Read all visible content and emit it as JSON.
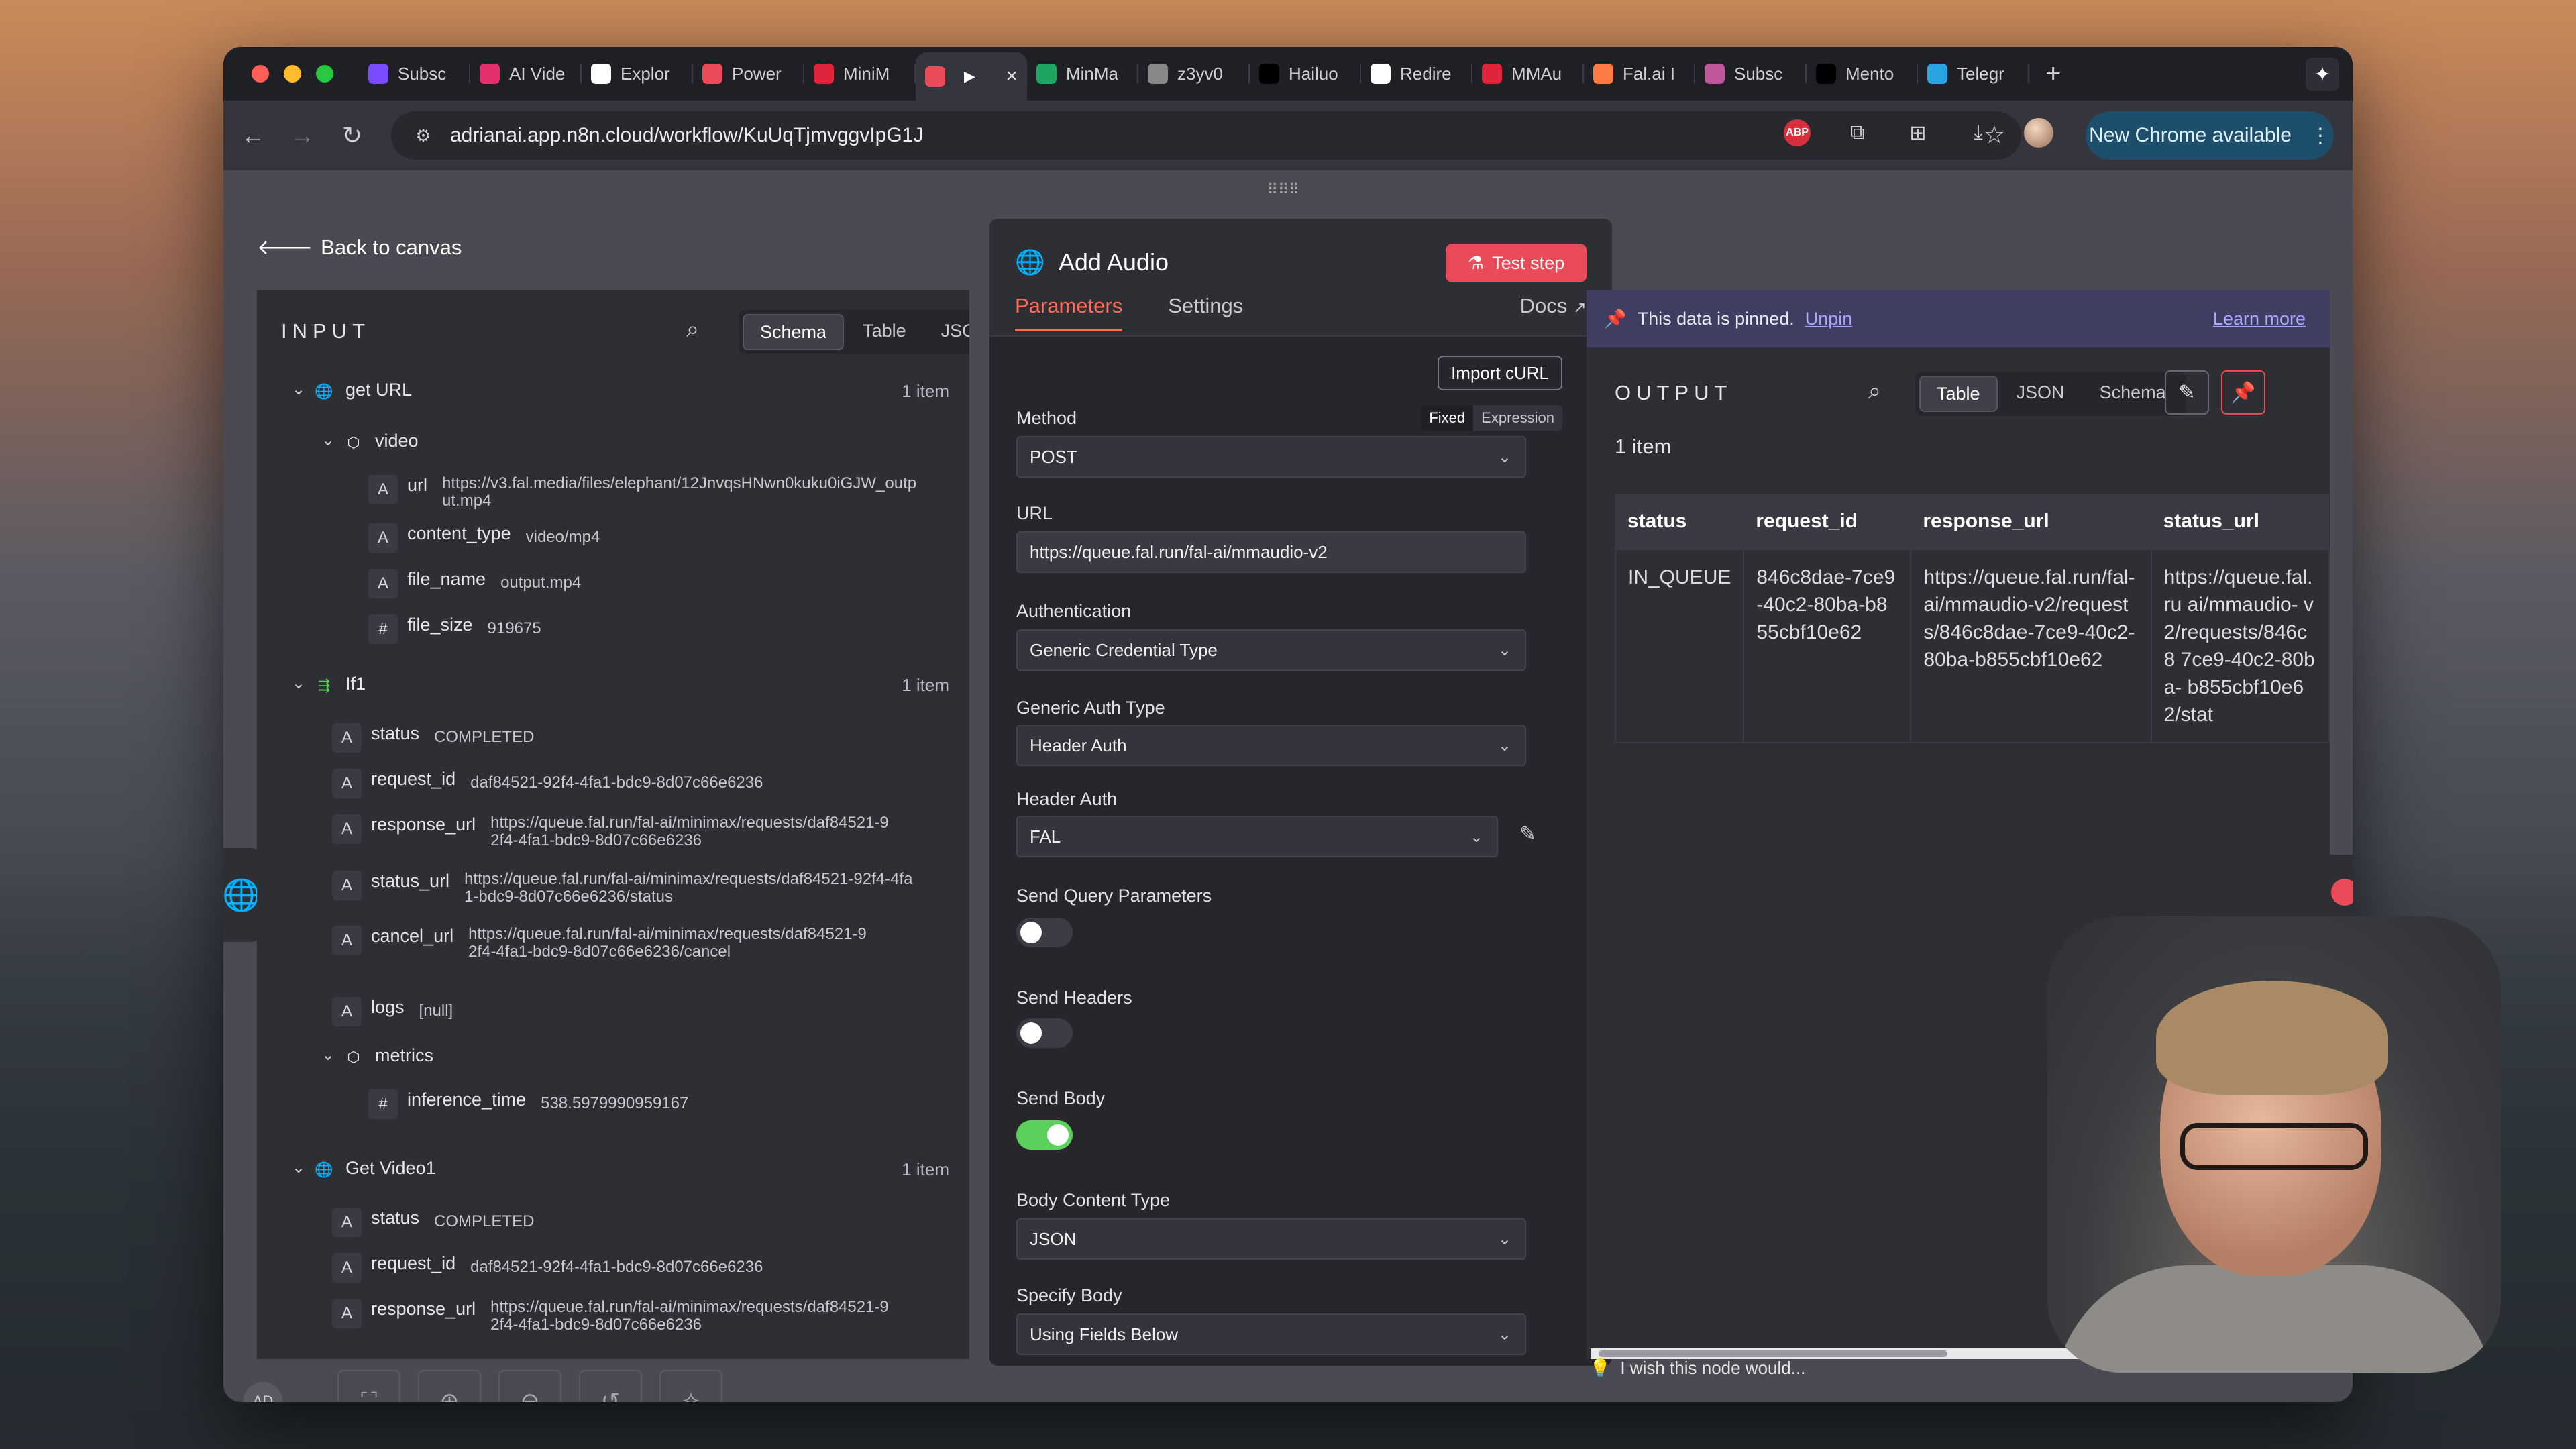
{
  "browser": {
    "tabs": [
      {
        "label": "Subsc",
        "icon": "purple-app-icon",
        "color": "#7a4cff"
      },
      {
        "label": "AI Vide",
        "icon": "instagram-icon",
        "color": "#e1306c"
      },
      {
        "label": "Explor",
        "icon": "document-icon",
        "color": "#ffffff"
      },
      {
        "label": "Power",
        "icon": "n8n-icon",
        "color": "#ea4b58"
      },
      {
        "label": "MiniM",
        "icon": "minimax-icon",
        "color": "#e0243c"
      },
      {
        "label": "",
        "icon": "n8n-icon",
        "color": "#ea4b58",
        "active": true
      },
      {
        "label": "MinMa",
        "icon": "sheets-icon",
        "color": "#1fa463"
      },
      {
        "label": "z3yv0",
        "icon": "globe-icon",
        "color": "#888888"
      },
      {
        "label": "Hailuo",
        "icon": "threads-icon",
        "color": "#000000"
      },
      {
        "label": "Redire",
        "icon": "google-icon",
        "color": "#ffffff"
      },
      {
        "label": "MMAu",
        "icon": "minimax-icon",
        "color": "#e0243c"
      },
      {
        "label": "Fal.ai I",
        "icon": "fal-icon",
        "color": "#ff7a45"
      },
      {
        "label": "Subsc",
        "icon": "app-icon",
        "color": "#c0589b"
      },
      {
        "label": "Mento",
        "icon": "x-icon",
        "color": "#000000"
      },
      {
        "label": "Telegr",
        "icon": "telegram-icon",
        "color": "#2aa3e0"
      }
    ],
    "url": "adrianai.app.n8n.cloud/workflow/KuUqTjmvggvIpG1J",
    "new_chrome_label": "New Chrome available"
  },
  "app": {
    "back_label": "Back to canvas",
    "input": {
      "title": "INPUT",
      "views": [
        "Schema",
        "Table",
        "JSON"
      ],
      "active_view": "Schema"
    },
    "node": {
      "title": "Add Audio",
      "test_label": "Test step",
      "tabs": [
        "Parameters",
        "Settings"
      ],
      "docs_label": "Docs",
      "import_label": "Import cURL",
      "fixed_label": "Fixed",
      "expression_label": "Expression",
      "fields": {
        "method_label": "Method",
        "method_value": "POST",
        "url_label": "URL",
        "url_value": "https://queue.fal.run/fal-ai/mmaudio-v2",
        "auth_label": "Authentication",
        "auth_value": "Generic Credential Type",
        "gen_auth_label": "Generic Auth Type",
        "gen_auth_value": "Header Auth",
        "header_auth_label": "Header Auth",
        "header_auth_value": "FAL",
        "send_query_label": "Send Query Parameters",
        "send_headers_label": "Send Headers",
        "send_body_label": "Send Body",
        "body_type_label": "Body Content Type",
        "body_type_value": "JSON",
        "specify_body_label": "Specify Body",
        "specify_body_value": "Using Fields Below"
      },
      "toggles": {
        "send_query": false,
        "send_headers": false,
        "send_body": true
      }
    },
    "output": {
      "pinned_text": "This data is pinned.",
      "unpin_label": "Unpin",
      "learn_more_label": "Learn more",
      "title": "OUTPUT",
      "views": [
        "Table",
        "JSON",
        "Schema"
      ],
      "count": "1 item",
      "table": {
        "headers": [
          "status",
          "request_id",
          "response_url",
          "status_url"
        ],
        "row": [
          "IN_QUEUE",
          "846c8dae-7ce9-40c2-80ba-b855cbf10e62",
          "https://queue.fal.run/fal-ai/mmaudio-v2/requests/846c8dae-7ce9-40c2-80ba-b855cbf10e62",
          "https://queue.fal.ru ai/mmaudio- v2/requests/846c8 7ce9-40c2-80ba- b855cbf10e62/stat"
        ]
      }
    },
    "wish_label": "I wish this node would...",
    "user_initials": "AD"
  },
  "tree": {
    "get_url": {
      "name": "get URL",
      "count": "1 item"
    },
    "video": "video",
    "url_key": "url",
    "url_val": "https://v3.fal.media/files/elephant/12JnvqsHNwn0kuku0iGJW_output.mp4",
    "content_type_key": "content_type",
    "content_type_val": "video/mp4",
    "file_name_key": "file_name",
    "file_name_val": "output.mp4",
    "file_size_key": "file_size",
    "file_size_val": "919675",
    "if1": {
      "name": "If1",
      "count": "1 item"
    },
    "status_key": "status",
    "status_val": "COMPLETED",
    "request_id_key": "request_id",
    "request_id_val": "daf84521-92f4-4fa1-bdc9-8d07c66e6236",
    "response_url_key": "response_url",
    "response_url_val": "https://queue.fal.run/fal-ai/minimax/requests/daf84521-92f4-4fa1-bdc9-8d07c66e6236",
    "status_url_key": "status_url",
    "status_url_val": "https://queue.fal.run/fal-ai/minimax/requests/daf84521-92f4-4fa1-bdc9-8d07c66e6236/status",
    "cancel_url_key": "cancel_url",
    "cancel_url_val": "https://queue.fal.run/fal-ai/minimax/requests/daf84521-92f4-4fa1-bdc9-8d07c66e6236/cancel",
    "logs_key": "logs",
    "logs_val": "[null]",
    "metrics": "metrics",
    "inference_key": "inference_time",
    "inference_val": "538.5979990959167",
    "get_video1": {
      "name": "Get Video1",
      "count": "1 item"
    },
    "status2_val": "COMPLETED",
    "request_id2_val": "daf84521-92f4-4fa1-bdc9-8d07c66e6236",
    "response_url2_val": "https://queue.fal.run/fal-ai/minimax/requests/daf84521-92f4-4fa1-bdc9-8d07c66e6236"
  }
}
